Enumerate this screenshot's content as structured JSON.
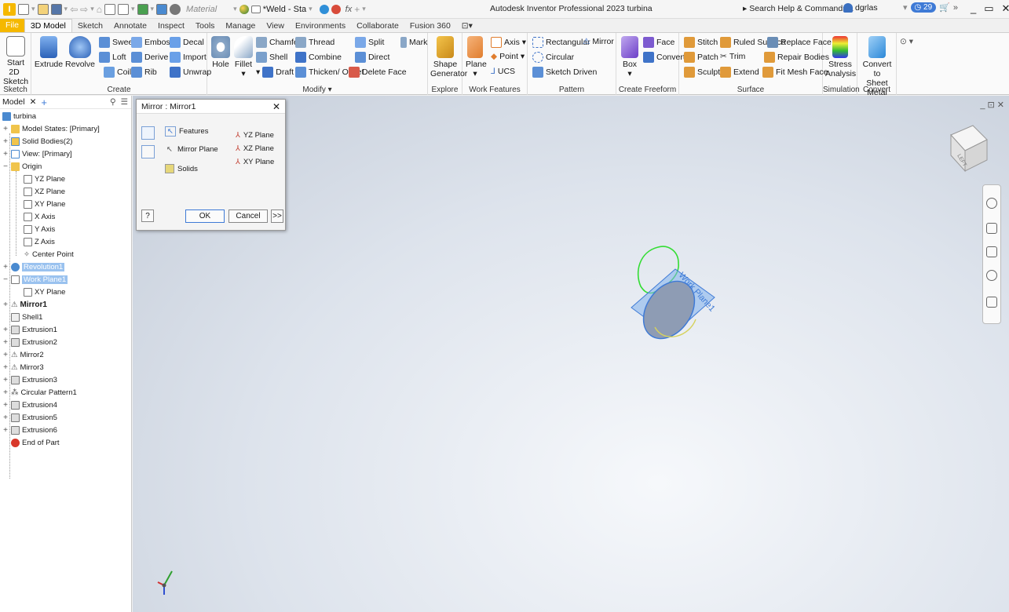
{
  "app": {
    "title": "Autodesk Inventor Professional 2023  turbina",
    "logo": "I"
  },
  "quick_access": {
    "material": "Material",
    "weld": "*Weld - Sta",
    "fx": "fx"
  },
  "search": {
    "label": "▸ Search Help & Commands..."
  },
  "user": {
    "name": "dgrlas"
  },
  "timer": {
    "count": "29"
  },
  "tabs": [
    {
      "label": "File"
    },
    {
      "label": "3D Model"
    },
    {
      "label": "Sketch"
    },
    {
      "label": "Annotate"
    },
    {
      "label": "Inspect"
    },
    {
      "label": "Tools"
    },
    {
      "label": "Manage"
    },
    {
      "label": "View"
    },
    {
      "label": "Environments"
    },
    {
      "label": "Collaborate"
    },
    {
      "label": "Fusion 360"
    }
  ],
  "ribbon": {
    "sketch": {
      "label": "Sketch",
      "start": "Start",
      "sketch2d": "2D Sketch"
    },
    "create": {
      "label": "Create",
      "extrude": "Extrude",
      "revolve": "Revolve",
      "sweep": "Sweep",
      "loft": "Loft",
      "coil": "Coil",
      "emboss": "Emboss",
      "derive": "Derive",
      "rib": "Rib",
      "decal": "Decal",
      "import": "Import",
      "unwrap": "Unwrap"
    },
    "modify": {
      "label": "Modify ▾",
      "hole": "Hole",
      "fillet": "Fillet",
      "chamfer": "Chamfer",
      "shell": "Shell",
      "draft": "Draft",
      "thread": "Thread",
      "combine": "Combine",
      "thicken": "Thicken/ Offset",
      "split": "Split",
      "direct": "Direct",
      "delete_face": "Delete Face",
      "mark": "Mark"
    },
    "explore": {
      "label": "Explore",
      "shape": "Shape",
      "generator": "Generator"
    },
    "work_features": {
      "label": "Work Features",
      "plane": "Plane",
      "axis": "Axis ▾",
      "point": "Point ▾",
      "ucs": "UCS"
    },
    "pattern": {
      "label": "Pattern",
      "rectangular": "Rectangular",
      "mirror": "Mirror",
      "circular": "Circular",
      "sketch_driven": "Sketch Driven"
    },
    "freeform": {
      "label": "Create Freeform",
      "box": "Box",
      "face": "Face",
      "convert": "Convert"
    },
    "surface": {
      "label": "Surface",
      "stitch": "Stitch",
      "ruled": "Ruled Surface",
      "replace": "Replace Face",
      "patch": "Patch",
      "trim": "Trim",
      "repair": "Repair Bodies",
      "sculpt": "Sculpt",
      "extend": "Extend",
      "fit": "Fit Mesh Face"
    },
    "simulation": {
      "label": "Simulation",
      "stress": "Stress",
      "analysis": "Analysis"
    },
    "convert": {
      "label": "Convert",
      "to": "Convert to",
      "sheet": "Sheet Metal"
    }
  },
  "browser": {
    "tab": "Model",
    "nodes": [
      {
        "label": "turbina"
      },
      {
        "label": "Model States: [Primary]"
      },
      {
        "label": "Solid Bodies(2)"
      },
      {
        "label": "View: [Primary]"
      },
      {
        "label": "Origin"
      },
      {
        "label": "YZ Plane"
      },
      {
        "label": "XZ Plane"
      },
      {
        "label": "XY Plane"
      },
      {
        "label": "X Axis"
      },
      {
        "label": "Y Axis"
      },
      {
        "label": "Z Axis"
      },
      {
        "label": "Center Point"
      },
      {
        "label": "Revolution1"
      },
      {
        "label": "Work Plane1"
      },
      {
        "label": "XY Plane"
      },
      {
        "label": "Mirror1"
      },
      {
        "label": "Shell1"
      },
      {
        "label": "Extrusion1"
      },
      {
        "label": "Extrusion2"
      },
      {
        "label": "Mirror2"
      },
      {
        "label": "Mirror3"
      },
      {
        "label": "Extrusion3"
      },
      {
        "label": "Circular Pattern1"
      },
      {
        "label": "Extrusion4"
      },
      {
        "label": "Extrusion5"
      },
      {
        "label": "Extrusion6"
      },
      {
        "label": "End of Part"
      }
    ]
  },
  "dialog": {
    "title": "Mirror : Mirror1",
    "features": "Features",
    "mirror_plane": "Mirror Plane",
    "solids": "Solids",
    "yz": "YZ Plane",
    "xz": "XZ Plane",
    "xy": "XY Plane",
    "ok": "OK",
    "cancel": "Cancel",
    "more": ">>",
    "help": "?"
  },
  "viewport": {
    "workplane_label": "Work Plane1",
    "viewcube": "LEFT"
  },
  "colors": {
    "accent": "#3e7ad6",
    "file_tab": "#f5b800",
    "selection": "#9ac2ef"
  }
}
